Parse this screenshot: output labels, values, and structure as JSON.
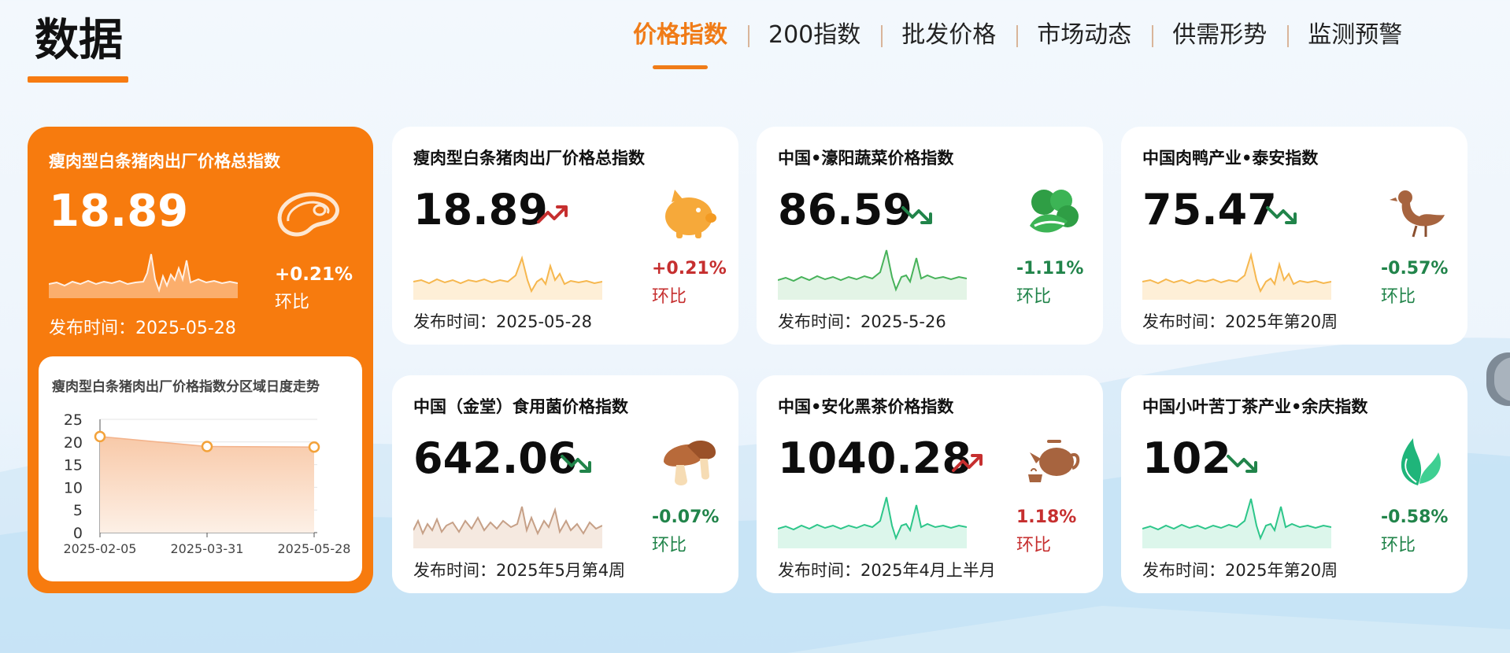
{
  "header": {
    "title": "数据",
    "tabs": [
      {
        "label": "价格指数",
        "active": true
      },
      {
        "label": "200指数",
        "active": false
      },
      {
        "label": "批发价格",
        "active": false
      },
      {
        "label": "市场动态",
        "active": false
      },
      {
        "label": "供需形势",
        "active": false
      },
      {
        "label": "监测预警",
        "active": false
      }
    ]
  },
  "colors": {
    "accent": "#f77b0e",
    "up": "#c62f2f",
    "down": "#21844a"
  },
  "hero": {
    "title": "瘦肉型白条猪肉出厂价格总指数",
    "value": "18.89",
    "change": "+0.21%",
    "change_label": "环比",
    "date": "发布时间：2025-05-28",
    "icon": "meat-icon",
    "chart": {
      "title": "瘦肉型白条猪肉出厂价格指数分区域日度走势",
      "type": "area",
      "y_ticks": [
        "25",
        "20",
        "15",
        "10",
        "5",
        "0"
      ],
      "ylim": [
        0,
        25
      ],
      "x_labels": [
        "2025-02-05",
        "2025-03-31",
        "2025-05-28"
      ],
      "points": [
        {
          "x": "2025-02-05",
          "y": 21.2
        },
        {
          "x": "2025-03-31",
          "y": 19.0
        },
        {
          "x": "2025-05-28",
          "y": 18.89
        }
      ]
    }
  },
  "cards": [
    {
      "title": "瘦肉型白条猪肉出厂价格总指数",
      "value": "18.89",
      "trend": "up",
      "icon": "pig-icon",
      "change": "+0.21%",
      "change_label": "环比",
      "date": "发布时间：2025-05-28",
      "spark_color": "#f6b74e"
    },
    {
      "title": "中国•濠阳蔬菜价格指数",
      "value": "86.59",
      "trend": "down",
      "icon": "vegetable-icon",
      "change": "-1.11%",
      "change_label": "环比",
      "date": "发布时间：2025-5-26",
      "spark_color": "#47b25a"
    },
    {
      "title": "中国肉鸭产业•泰安指数",
      "value": "75.47",
      "trend": "down",
      "icon": "duck-icon",
      "change": "-0.57%",
      "change_label": "环比",
      "date": "发布时间：2025年第20周",
      "spark_color": "#f6b74e"
    },
    {
      "title": "中国（金堂）食用菌价格指数",
      "value": "642.06",
      "trend": "down",
      "icon": "mushroom-icon",
      "change": "-0.07%",
      "change_label": "环比",
      "date": "发布时间：2025年5月第4周",
      "spark_color": "#c6a087"
    },
    {
      "title": "中国•安化黑茶价格指数",
      "value": "1040.28",
      "trend": "up",
      "icon": "teapot-icon",
      "change": "1.18%",
      "change_label": "环比",
      "date": "发布时间：2025年4月上半月",
      "spark_color": "#2dc68a"
    },
    {
      "title": "中国小叶苦丁茶产业•余庆指数",
      "value": "102",
      "trend": "down",
      "icon": "tea-leaf-icon",
      "change": "-0.58%",
      "change_label": "环比",
      "date": "发布时间：2025年第20周",
      "spark_color": "#2dc68a"
    }
  ]
}
